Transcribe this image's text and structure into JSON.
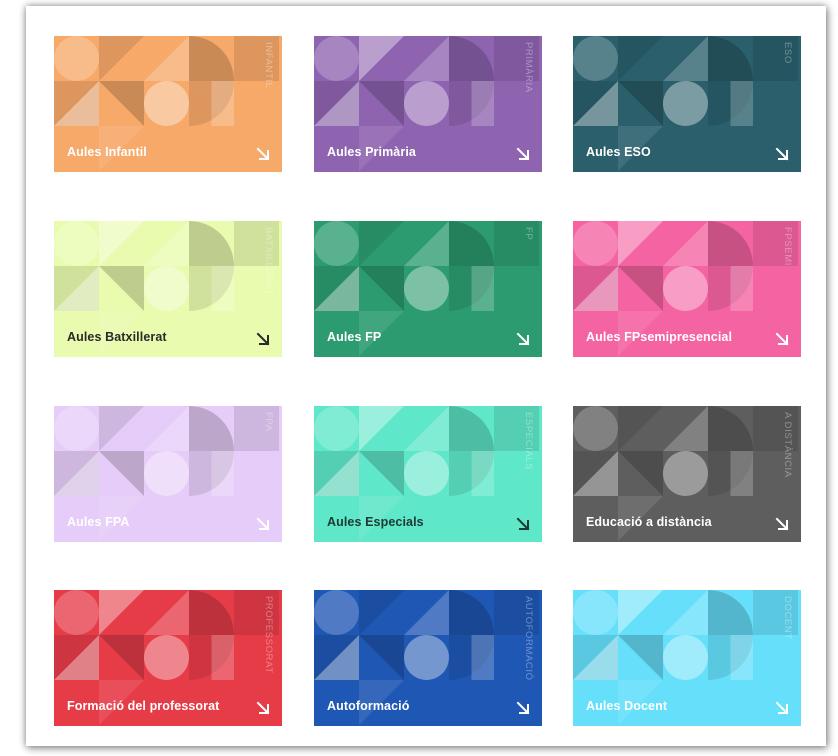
{
  "cards": [
    {
      "label": "Aules Infantil",
      "tag": "INFANTIL",
      "bg": "#F6A969",
      "ink": "#ffffff",
      "arrow": "#ffffff"
    },
    {
      "label": "Aules Primària",
      "tag": "PRIMÀRIA",
      "bg": "#8E63B0",
      "ink": "#ffffff",
      "arrow": "#ffffff"
    },
    {
      "label": "Aules ESO",
      "tag": "ESO",
      "bg": "#2A5F6B",
      "ink": "#ffffff",
      "arrow": "#ffffff"
    },
    {
      "label": "Aules Batxillerat",
      "tag": "BATXILLERAT",
      "bg": "#E8FBAE",
      "ink": "#2a2a2a",
      "arrow": "#2a2a2a"
    },
    {
      "label": "Aules FP",
      "tag": "FP",
      "bg": "#2C9C70",
      "ink": "#ffffff",
      "arrow": "#ffffff"
    },
    {
      "label": "Aules FPsemipresencial",
      "tag": "FPSEMI",
      "bg": "#F463A2",
      "ink": "#ffffff",
      "arrow": "#ffffff"
    },
    {
      "label": "Aules FPA",
      "tag": "FPA",
      "bg": "#E6CCF8",
      "ink": "#ffffff",
      "arrow": "#ffffff"
    },
    {
      "label": "Aules Especials",
      "tag": "ESPECIALS",
      "bg": "#5EE7C8",
      "ink": "#1e3a34",
      "arrow": "#1e3a34"
    },
    {
      "label": "Educació a distància",
      "tag": "A DISTÀNCIA",
      "bg": "#5E5E5E",
      "ink": "#ffffff",
      "arrow": "#ffffff"
    },
    {
      "label": "Formació del professorat",
      "tag": "PROFESSORAT",
      "bg": "#E63C48",
      "ink": "#ffffff",
      "arrow": "#ffffff"
    },
    {
      "label": "Autoformació",
      "tag": "AUTOFORMACIÓ",
      "bg": "#1F57B4",
      "ink": "#ffffff",
      "arrow": "#ffffff"
    },
    {
      "label": "Aules Docent",
      "tag": "DOCENT",
      "bg": "#66DFFB",
      "ink": "#ffffff",
      "arrow": "#ffffff"
    }
  ],
  "icons": {
    "arrow": "arrow-down-right-icon"
  }
}
